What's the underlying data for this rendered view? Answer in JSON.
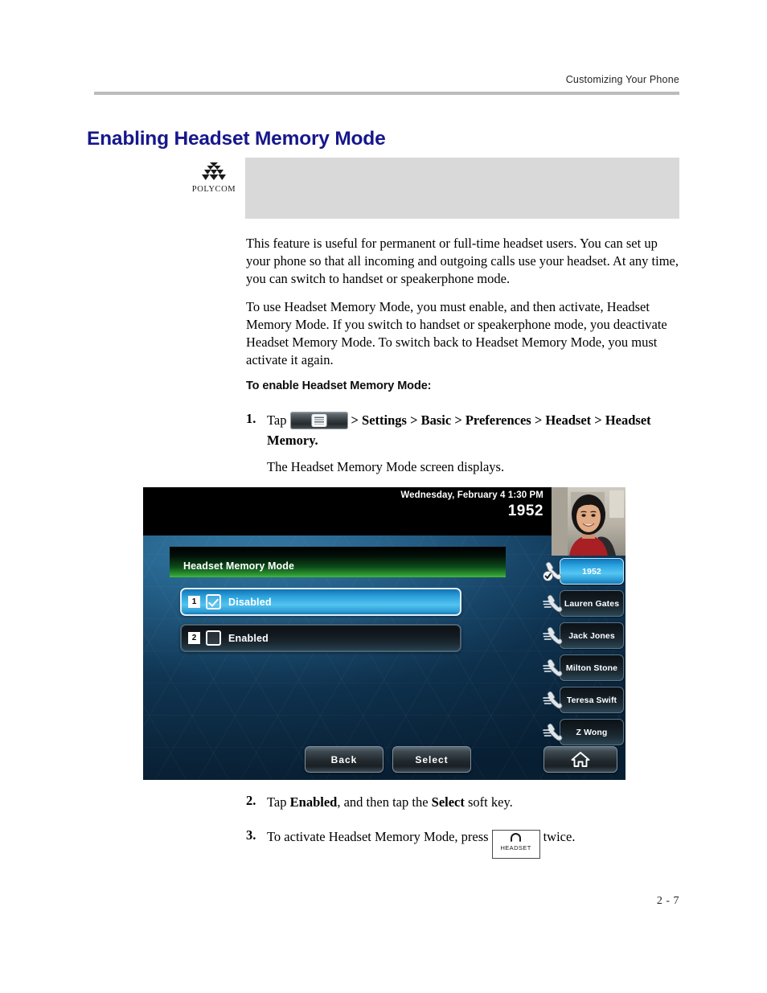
{
  "header": {
    "running_head": "Customizing Your Phone"
  },
  "section": {
    "title": "Enabling Headset Memory Mode",
    "title_color": "#16178c"
  },
  "note": {
    "logo_wordmark": "POLYCOM",
    "box_text": "",
    "box_color": "#d9d9d9"
  },
  "body": {
    "paragraphs": [
      "This feature is useful for permanent or full-time headset users. You can set up your phone so that all incoming and outgoing calls use your headset. At any time, you can switch to handset or speakerphone mode.",
      "To use Headset Memory Mode, you must enable, and then activate, Headset Memory Mode. If you switch to handset or speakerphone mode, you deactivate Headset Memory Mode. To switch back to Headset Memory Mode, you must activate it again."
    ]
  },
  "procedure": {
    "title": "To enable Headset Memory Mode:",
    "steps": [
      {
        "num": "1.",
        "lead": "Tap",
        "menu_key_icon": "menu-key-icon",
        "path": "> Settings > Basic > Preferences > Headset > Headset Memory.",
        "result": "The Headset Memory Mode screen displays."
      },
      {
        "num": "2.",
        "text_1": "Tap ",
        "bold_1": "Enabled",
        "text_2": ", and then tap the ",
        "bold_2": "Select",
        "text_3": " soft key."
      },
      {
        "num": "3.",
        "text_1": "To activate Headset Memory Mode, press",
        "key_label": "HEADSET",
        "text_2": "twice."
      }
    ]
  },
  "phone_screen": {
    "status_bar": {
      "datetime": "Wednesday, February 4  1:30 PM",
      "extension": "1952"
    },
    "avatar": "user-photo",
    "title_bar": {
      "label": "Headset Memory Mode",
      "accent_color": "#46b93c"
    },
    "options": [
      {
        "index": "1",
        "label": "Disabled",
        "checked": true,
        "selected": true
      },
      {
        "index": "2",
        "label": "Enabled",
        "checked": false,
        "selected": false
      }
    ],
    "line_keys": [
      {
        "label": "1952",
        "active": true,
        "icon": "handset-registered-icon"
      },
      {
        "label": "Lauren Gates",
        "active": false,
        "icon": "handset-icon"
      },
      {
        "label": "Jack Jones",
        "active": false,
        "icon": "handset-icon"
      },
      {
        "label": "Milton Stone",
        "active": false,
        "icon": "handset-icon"
      },
      {
        "label": "Teresa Swift",
        "active": false,
        "icon": "handset-icon"
      },
      {
        "label": "Z Wong",
        "active": false,
        "icon": "handset-icon"
      }
    ],
    "soft_keys": [
      {
        "label": "Back"
      },
      {
        "label": "Select"
      },
      {
        "label": "",
        "icon": "home-icon"
      }
    ],
    "selected_accent": "#53c3ef"
  },
  "footer": {
    "page_number": "2 - 7"
  }
}
